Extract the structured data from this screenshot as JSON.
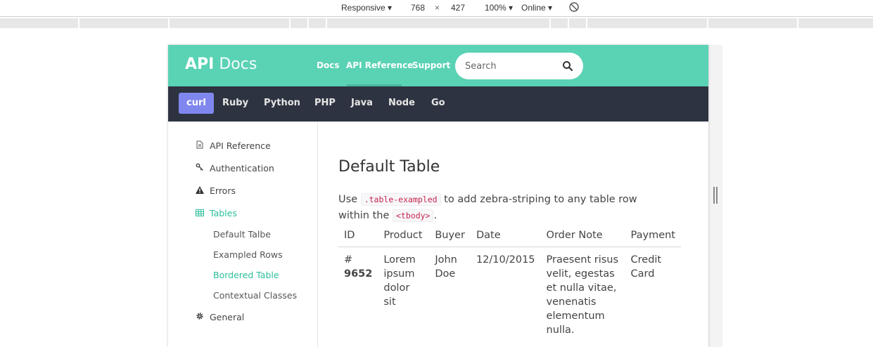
{
  "devtools": {
    "device": "Responsive",
    "width": "768",
    "times": "×",
    "height": "427",
    "zoom": "100%",
    "network": "Online"
  },
  "app": {
    "logo_bold": "API",
    "logo_light": "Docs",
    "nav": [
      "Docs",
      "API Reference",
      "Support"
    ],
    "active_nav": "API Reference",
    "search_placeholder": "Search"
  },
  "languages": [
    "curl",
    "Ruby",
    "Python",
    "PHP",
    "Java",
    "Node",
    "Go"
  ],
  "active_language": "curl",
  "sidebar": {
    "items": [
      {
        "label": "API Reference",
        "icon": "document-icon"
      },
      {
        "label": "Authentication",
        "icon": "key-icon"
      },
      {
        "label": "Errors",
        "icon": "warning-icon"
      },
      {
        "label": "Tables",
        "icon": "table-icon"
      },
      {
        "label": "General",
        "icon": "gear-icon"
      }
    ],
    "subitems": [
      "Default Talbe",
      "Exampled Rows",
      "Bordered Table",
      "Contextual Classes"
    ],
    "active_item": "Tables",
    "active_subitem": "Bordered Table"
  },
  "content": {
    "title": "Default Table",
    "text_before": "Use",
    "code1": ".table-exampled",
    "text_middle": "to add zebra-striping to any table row within the",
    "code2": "<tbody>",
    "text_after": ".",
    "table": {
      "headers": [
        "ID",
        "Product",
        "Buyer",
        "Date",
        "Order Note",
        "Payment"
      ],
      "rows": [
        {
          "id_prefix": "#",
          "id_number": "9652",
          "product": "Lorem ipsum dolor sit",
          "buyer": "John Doe",
          "date": "12/10/2015",
          "note": "Praesent risus velit, egestas et nulla vitae, venenatis elementum nulla.",
          "payment": "Credit Card"
        }
      ]
    }
  },
  "colors": {
    "header": "#5ad2b4",
    "langbar": "#2d3340",
    "active_lang": "#7f87ee",
    "accent": "#2bbf9a"
  }
}
